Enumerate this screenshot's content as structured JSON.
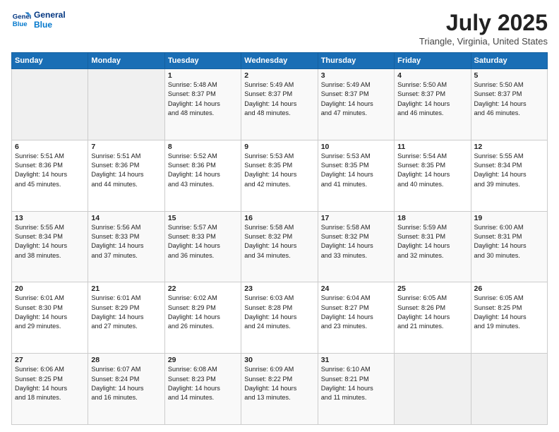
{
  "header": {
    "logo_line1": "General",
    "logo_line2": "Blue",
    "month_title": "July 2025",
    "location": "Triangle, Virginia, United States"
  },
  "weekdays": [
    "Sunday",
    "Monday",
    "Tuesday",
    "Wednesday",
    "Thursday",
    "Friday",
    "Saturday"
  ],
  "weeks": [
    [
      {
        "day": "",
        "info": ""
      },
      {
        "day": "",
        "info": ""
      },
      {
        "day": "1",
        "info": "Sunrise: 5:48 AM\nSunset: 8:37 PM\nDaylight: 14 hours\nand 48 minutes."
      },
      {
        "day": "2",
        "info": "Sunrise: 5:49 AM\nSunset: 8:37 PM\nDaylight: 14 hours\nand 48 minutes."
      },
      {
        "day": "3",
        "info": "Sunrise: 5:49 AM\nSunset: 8:37 PM\nDaylight: 14 hours\nand 47 minutes."
      },
      {
        "day": "4",
        "info": "Sunrise: 5:50 AM\nSunset: 8:37 PM\nDaylight: 14 hours\nand 46 minutes."
      },
      {
        "day": "5",
        "info": "Sunrise: 5:50 AM\nSunset: 8:37 PM\nDaylight: 14 hours\nand 46 minutes."
      }
    ],
    [
      {
        "day": "6",
        "info": "Sunrise: 5:51 AM\nSunset: 8:36 PM\nDaylight: 14 hours\nand 45 minutes."
      },
      {
        "day": "7",
        "info": "Sunrise: 5:51 AM\nSunset: 8:36 PM\nDaylight: 14 hours\nand 44 minutes."
      },
      {
        "day": "8",
        "info": "Sunrise: 5:52 AM\nSunset: 8:36 PM\nDaylight: 14 hours\nand 43 minutes."
      },
      {
        "day": "9",
        "info": "Sunrise: 5:53 AM\nSunset: 8:35 PM\nDaylight: 14 hours\nand 42 minutes."
      },
      {
        "day": "10",
        "info": "Sunrise: 5:53 AM\nSunset: 8:35 PM\nDaylight: 14 hours\nand 41 minutes."
      },
      {
        "day": "11",
        "info": "Sunrise: 5:54 AM\nSunset: 8:35 PM\nDaylight: 14 hours\nand 40 minutes."
      },
      {
        "day": "12",
        "info": "Sunrise: 5:55 AM\nSunset: 8:34 PM\nDaylight: 14 hours\nand 39 minutes."
      }
    ],
    [
      {
        "day": "13",
        "info": "Sunrise: 5:55 AM\nSunset: 8:34 PM\nDaylight: 14 hours\nand 38 minutes."
      },
      {
        "day": "14",
        "info": "Sunrise: 5:56 AM\nSunset: 8:33 PM\nDaylight: 14 hours\nand 37 minutes."
      },
      {
        "day": "15",
        "info": "Sunrise: 5:57 AM\nSunset: 8:33 PM\nDaylight: 14 hours\nand 36 minutes."
      },
      {
        "day": "16",
        "info": "Sunrise: 5:58 AM\nSunset: 8:32 PM\nDaylight: 14 hours\nand 34 minutes."
      },
      {
        "day": "17",
        "info": "Sunrise: 5:58 AM\nSunset: 8:32 PM\nDaylight: 14 hours\nand 33 minutes."
      },
      {
        "day": "18",
        "info": "Sunrise: 5:59 AM\nSunset: 8:31 PM\nDaylight: 14 hours\nand 32 minutes."
      },
      {
        "day": "19",
        "info": "Sunrise: 6:00 AM\nSunset: 8:31 PM\nDaylight: 14 hours\nand 30 minutes."
      }
    ],
    [
      {
        "day": "20",
        "info": "Sunrise: 6:01 AM\nSunset: 8:30 PM\nDaylight: 14 hours\nand 29 minutes."
      },
      {
        "day": "21",
        "info": "Sunrise: 6:01 AM\nSunset: 8:29 PM\nDaylight: 14 hours\nand 27 minutes."
      },
      {
        "day": "22",
        "info": "Sunrise: 6:02 AM\nSunset: 8:29 PM\nDaylight: 14 hours\nand 26 minutes."
      },
      {
        "day": "23",
        "info": "Sunrise: 6:03 AM\nSunset: 8:28 PM\nDaylight: 14 hours\nand 24 minutes."
      },
      {
        "day": "24",
        "info": "Sunrise: 6:04 AM\nSunset: 8:27 PM\nDaylight: 14 hours\nand 23 minutes."
      },
      {
        "day": "25",
        "info": "Sunrise: 6:05 AM\nSunset: 8:26 PM\nDaylight: 14 hours\nand 21 minutes."
      },
      {
        "day": "26",
        "info": "Sunrise: 6:05 AM\nSunset: 8:25 PM\nDaylight: 14 hours\nand 19 minutes."
      }
    ],
    [
      {
        "day": "27",
        "info": "Sunrise: 6:06 AM\nSunset: 8:25 PM\nDaylight: 14 hours\nand 18 minutes."
      },
      {
        "day": "28",
        "info": "Sunrise: 6:07 AM\nSunset: 8:24 PM\nDaylight: 14 hours\nand 16 minutes."
      },
      {
        "day": "29",
        "info": "Sunrise: 6:08 AM\nSunset: 8:23 PM\nDaylight: 14 hours\nand 14 minutes."
      },
      {
        "day": "30",
        "info": "Sunrise: 6:09 AM\nSunset: 8:22 PM\nDaylight: 14 hours\nand 13 minutes."
      },
      {
        "day": "31",
        "info": "Sunrise: 6:10 AM\nSunset: 8:21 PM\nDaylight: 14 hours\nand 11 minutes."
      },
      {
        "day": "",
        "info": ""
      },
      {
        "day": "",
        "info": ""
      }
    ]
  ]
}
